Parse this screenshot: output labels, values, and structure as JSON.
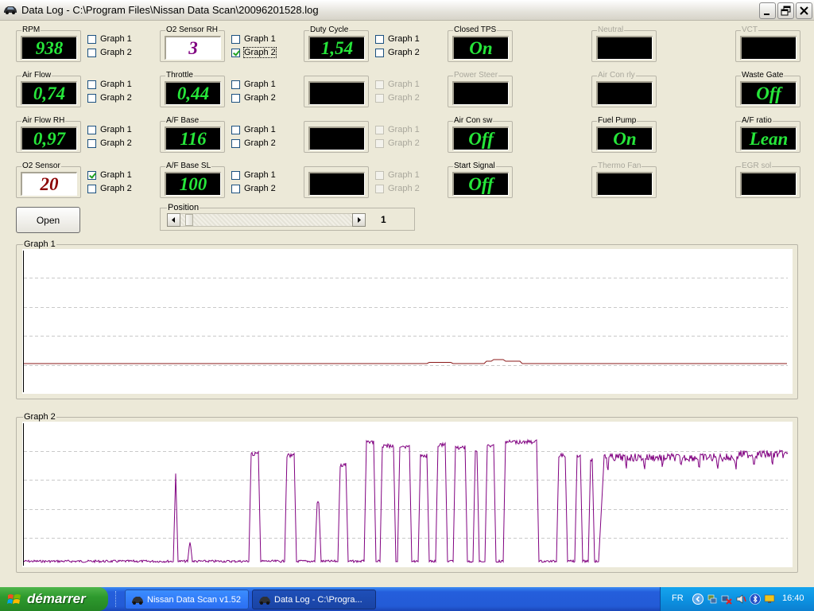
{
  "window": {
    "title": "Data Log - C:\\Program Files\\Nissan Data Scan\\20096201528.log",
    "controls": [
      "minimize",
      "maximize",
      "close"
    ]
  },
  "channels": [
    {
      "id": "rpm",
      "label": "RPM",
      "value": "938",
      "style": "green",
      "graph1": false,
      "graph2": false,
      "enabled": true
    },
    {
      "id": "o2-sensor-rh",
      "label": "O2 Sensor RH",
      "value": "3",
      "style": "purple-on-white",
      "graph1": false,
      "graph2": true,
      "enabled": true
    },
    {
      "id": "duty-cycle",
      "label": "Duty Cycle",
      "value": "1,54",
      "style": "green",
      "graph1": false,
      "graph2": false,
      "enabled": true
    },
    {
      "id": "air-flow",
      "label": "Air Flow",
      "value": "0,74",
      "style": "green",
      "graph1": false,
      "graph2": false,
      "enabled": true
    },
    {
      "id": "throttle",
      "label": "Throttle",
      "value": "0,44",
      "style": "green",
      "graph1": false,
      "graph2": false,
      "enabled": true
    },
    {
      "id": "blank-2",
      "label": "",
      "value": "",
      "style": "green",
      "graph1": false,
      "graph2": false,
      "enabled": false
    },
    {
      "id": "air-flow-rh",
      "label": "Air Flow RH",
      "value": "0,97",
      "style": "green",
      "graph1": false,
      "graph2": false,
      "enabled": true
    },
    {
      "id": "af-base",
      "label": "A/F Base",
      "value": "116",
      "style": "green",
      "graph1": false,
      "graph2": false,
      "enabled": true
    },
    {
      "id": "blank-3",
      "label": "",
      "value": "",
      "style": "green",
      "graph1": false,
      "graph2": false,
      "enabled": false
    },
    {
      "id": "o2-sensor",
      "label": "O2 Sensor",
      "value": "20",
      "style": "red-on-white",
      "graph1": true,
      "graph2": false,
      "enabled": true
    },
    {
      "id": "af-base-sl",
      "label": "A/F Base SL",
      "value": "100",
      "style": "green",
      "graph1": false,
      "graph2": false,
      "enabled": true
    },
    {
      "id": "blank-4",
      "label": "",
      "value": "",
      "style": "green",
      "graph1": false,
      "graph2": false,
      "enabled": false
    }
  ],
  "checkbox_labels": {
    "graph1": "Graph 1",
    "graph2": "Graph 2"
  },
  "status_indicators": [
    {
      "id": "closed-tps",
      "label": "Closed TPS",
      "value": "On",
      "enabled": true
    },
    {
      "id": "power-steer",
      "label": "Power Steer",
      "value": "",
      "enabled": false
    },
    {
      "id": "air-con-sw",
      "label": "Air Con sw",
      "value": "Off",
      "enabled": true
    },
    {
      "id": "start-signal",
      "label": "Start Signal",
      "value": "Off",
      "enabled": true
    },
    {
      "id": "neutral",
      "label": "Neutral",
      "value": "",
      "enabled": false
    },
    {
      "id": "air-con-rly",
      "label": "Air Con rly",
      "value": "",
      "enabled": false
    },
    {
      "id": "fuel-pump",
      "label": "Fuel Pump",
      "value": "On",
      "enabled": true
    },
    {
      "id": "thermo-fan",
      "label": "Thermo Fan",
      "value": "",
      "enabled": false
    },
    {
      "id": "vct",
      "label": "VCT",
      "value": "",
      "enabled": false
    },
    {
      "id": "waste-gate",
      "label": "Waste Gate",
      "value": "Off",
      "enabled": true
    },
    {
      "id": "af-ratio",
      "label": "A/F ratio",
      "value": "Lean",
      "enabled": true
    },
    {
      "id": "egr-sol",
      "label": "EGR sol",
      "value": "",
      "enabled": false
    }
  ],
  "open_button": {
    "label": "Open"
  },
  "position": {
    "label": "Position",
    "value": "1",
    "progress": 0.03
  },
  "graphs": [
    {
      "id": "graph1",
      "label": "Graph 1",
      "color": "#8b1a1a",
      "gridlines": 4
    },
    {
      "id": "graph2",
      "label": "Graph 2",
      "color": "#800080",
      "gridlines": 4
    }
  ],
  "colors": {
    "display_green": "#26e63a",
    "display_bg": "#000000",
    "o2_rh_text": "#800080",
    "o2_text": "#8b0000",
    "window_bg": "#ece9d8"
  },
  "taskbar": {
    "start_label": "démarrer",
    "tasks": [
      {
        "label": "Nissan Data Scan v1.52",
        "active": false
      },
      {
        "label": "Data Log - C:\\Progra...",
        "active": true
      }
    ],
    "language": "FR",
    "clock": "16:40"
  }
}
